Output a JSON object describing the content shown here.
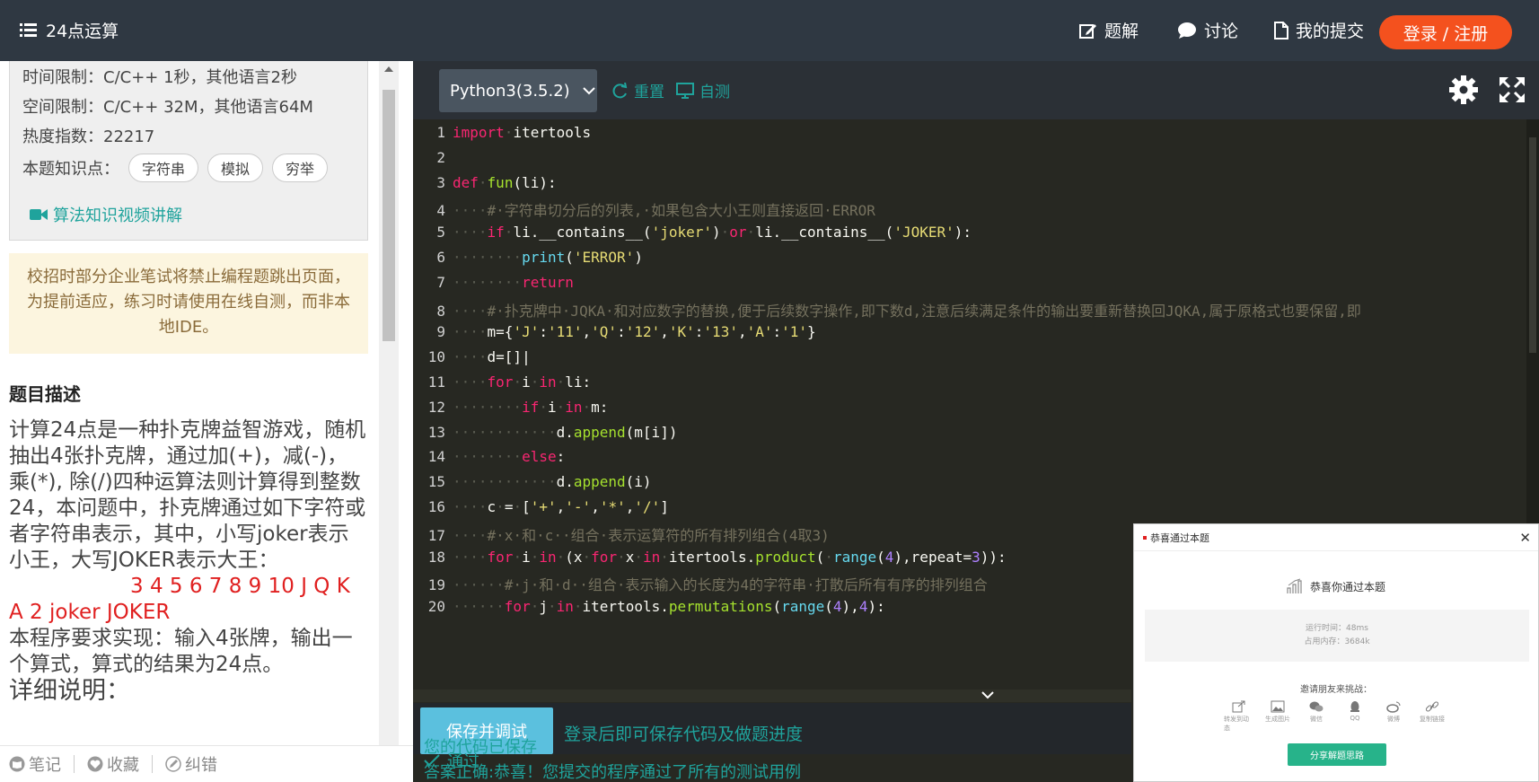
{
  "header": {
    "title": "24点运算",
    "nav": [
      {
        "label": "题解",
        "icon": "edit-icon"
      },
      {
        "label": "讨论",
        "icon": "chat-icon"
      },
      {
        "label": "我的提交",
        "icon": "file-icon"
      }
    ],
    "login_label": "登录 / 注册",
    "accent_color": "#f4511e"
  },
  "problem_info": {
    "time_limit": "时间限制：C/C++ 1秒，其他语言2秒",
    "space_limit": "空间限制：C/C++ 32M，其他语言64M",
    "heat": "热度指数：22217",
    "knowledge_label": "本题知识点：",
    "tags": [
      "字符串",
      "模拟",
      "穷举"
    ],
    "video_link": "算法知识视频讲解"
  },
  "notice": "校招时部分企业笔试将禁止编程题跳出页面，为提前适应，练习时请使用在线自测，而非本地IDE。",
  "description": {
    "title": "题目描述",
    "body": "计算24点是一种扑克牌益智游戏，随机抽出4张扑克牌，通过加(+)，减(-)，乘(*), 除(/)四种运算法则计算得到整数24，本问题中，扑克牌通过如下字符或者字符串表示，其中，小写joker表示小王，大写JOKER表示大王：",
    "cards_line1": "3 4 5 6 7 8 9 10 J Q K",
    "cards_line2": "A 2 joker JOKER",
    "requirement": "本程序要求实现：输入4张牌，输出一个算式，算式的结果为24点。",
    "detail_title": "详细说明："
  },
  "bottom_actions": [
    "笔记",
    "收藏",
    "纠错"
  ],
  "editor": {
    "language": "Python3(3.5.2)",
    "reset_label": "重置",
    "selftest_label": "自测",
    "lines": [
      {
        "n": "1",
        "html": "<span class=\"kw\">import</span><span class=\"dt\">·</span>itertools"
      },
      {
        "n": "2",
        "html": ""
      },
      {
        "n": "3",
        "html": "<span class=\"kw\">def</span><span class=\"dt\">·</span><span class=\"fn\">fun</span>(li):"
      },
      {
        "n": "4",
        "html": "<span class=\"dt\">····</span><span class=\"cm\">#·字符串切分后的列表,·如果包含大小王则直接返回·ERROR</span>"
      },
      {
        "n": "5",
        "html": "<span class=\"dt\">····</span><span class=\"kw\">if</span><span class=\"dt\">·</span>li.__contains__(<span class=\"st\">'joker'</span>)<span class=\"dt\">·</span><span class=\"kw\">or</span><span class=\"dt\">·</span>li.__contains__(<span class=\"st\">'JOKER'</span>):"
      },
      {
        "n": "6",
        "html": "<span class=\"dt\">········</span><span class=\"bi\">print</span>(<span class=\"st\">'ERROR'</span>)"
      },
      {
        "n": "7",
        "html": "<span class=\"dt\">········</span><span class=\"kw\">return</span>"
      },
      {
        "n": "8",
        "html": "<span class=\"dt\">····</span><span class=\"cm\">#·扑克牌中·JQKA·和对应数字的替换,便于后续数字操作,即下数d,注意后续满足条件的输出要重新替换回JQKA,属于原格式也要保留,即</span>"
      },
      {
        "n": "9",
        "html": "<span class=\"dt\">····</span>m={<span class=\"st\">'J'</span>:<span class=\"st\">'11'</span>,<span class=\"st\">'Q'</span>:<span class=\"st\">'12'</span>,<span class=\"st\">'K'</span>:<span class=\"st\">'13'</span>,<span class=\"st\">'A'</span>:<span class=\"st\">'1'</span>}"
      },
      {
        "n": "10",
        "html": "<span class=\"dt\">····</span>d=[]|"
      },
      {
        "n": "11",
        "html": "<span class=\"dt\">····</span><span class=\"kw\">for</span><span class=\"dt\">·</span>i<span class=\"dt\">·</span><span class=\"kw\">in</span><span class=\"dt\">·</span>li:"
      },
      {
        "n": "12",
        "html": "<span class=\"dt\">········</span><span class=\"kw\">if</span><span class=\"dt\">·</span>i<span class=\"dt\">·</span><span class=\"kw\">in</span><span class=\"dt\">·</span>m:"
      },
      {
        "n": "13",
        "html": "<span class=\"dt\">············</span>d.<span class=\"fn\">append</span>(m[i])"
      },
      {
        "n": "14",
        "html": "<span class=\"dt\">········</span><span class=\"kw\">else</span>:"
      },
      {
        "n": "15",
        "html": "<span class=\"dt\">············</span>d.<span class=\"fn\">append</span>(i)"
      },
      {
        "n": "16",
        "html": "<span class=\"dt\">····</span>c<span class=\"dt\">·</span>=<span class=\"dt\">·</span>[<span class=\"st\">'+'</span>,<span class=\"st\">'-'</span>,<span class=\"st\">'*'</span>,<span class=\"st\">'/'</span>]"
      },
      {
        "n": "17",
        "html": "<span class=\"dt\">····</span><span class=\"cm\">#·x·和·c··组合·表示运算符的所有排列组合(4取3)</span>"
      },
      {
        "n": "18",
        "html": "<span class=\"dt\">····</span><span class=\"kw\">for</span><span class=\"dt\">·</span>i<span class=\"dt\">·</span><span class=\"kw\">in</span><span class=\"dt\">·</span>(x<span class=\"dt\">·</span><span class=\"kw\">for</span><span class=\"dt\">·</span>x<span class=\"dt\">·</span><span class=\"kw\">in</span><span class=\"dt\">·</span>itertools.<span class=\"fn\">product</span>(<span class=\"dt\">·</span><span class=\"bi\">range</span>(<span class=\"nu\">4</span>),repeat=<span class=\"nu\">3</span>)):"
      },
      {
        "n": "19",
        "html": "<span class=\"dt\">······</span><span class=\"cm\">#·j·和·d··组合·表示输入的长度为4的字符串·打散后所有有序的排列组合</span>"
      },
      {
        "n": "20",
        "html": "<span class=\"dt\">······</span><span class=\"kw\">for</span><span class=\"dt\">·</span>j<span class=\"dt\">·</span><span class=\"kw\">in</span><span class=\"dt\">·</span>itertools.<span class=\"fn\">permutations</span>(<span class=\"bi\">range</span>(<span class=\"nu\">4</span>),<span class=\"nu\">4</span>):"
      }
    ],
    "save_button": "保存并调试",
    "save_hint": "登录后即可保存代码及做题进度"
  },
  "result": {
    "status": "通过",
    "saved": "您的代码已保存",
    "message": "答案正确:恭喜！您提交的程序通过了所有的测试用例"
  },
  "popup": {
    "title": "恭喜通过本题",
    "congrats": "恭喜你通过本题",
    "runtime": "运行时间：48ms",
    "memory": "占用内存：3684k",
    "invite": "邀请朋友来挑战：",
    "shares": [
      {
        "label": "转发到动态",
        "icon": "share-icon"
      },
      {
        "label": "生成图片",
        "icon": "image-icon"
      },
      {
        "label": "微信",
        "icon": "wechat-icon"
      },
      {
        "label": "QQ",
        "icon": "qq-icon"
      },
      {
        "label": "微博",
        "icon": "weibo-icon"
      },
      {
        "label": "复制链接",
        "icon": "link-icon"
      }
    ],
    "share_button": "分享解题思路"
  }
}
